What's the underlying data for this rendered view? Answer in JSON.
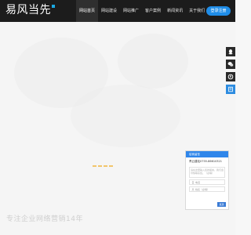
{
  "header": {
    "logo_text": "易风当先",
    "nav": [
      {
        "label": "网站首页",
        "active": true
      },
      {
        "label": "网站建设",
        "active": false
      },
      {
        "label": "网站推广",
        "active": false
      },
      {
        "label": "客户案例",
        "active": false
      },
      {
        "label": "新闻资讯",
        "active": false
      },
      {
        "label": "关于我们",
        "active": false
      }
    ],
    "login_label": "登录注册"
  },
  "hero": {
    "slogan": "专注企业网络营销14年"
  },
  "float_bar": {
    "icons": [
      "qq-icon",
      "wechat-icon",
      "phone-icon",
      "message-icon"
    ]
  },
  "message_widget": {
    "title": "给我留言",
    "phone_line": "青云建站0755-86610321",
    "textarea_placeholder": "请在这里输入您的留言，我们会尽快联系您。（必填）",
    "phone_placeholder": "电话",
    "name_placeholder": "姓名（必填）",
    "send_label": "发送"
  },
  "colors": {
    "header_bg": "#1c1c1c",
    "brand_blue": "#1f8de8",
    "loader": "#f2c56b"
  }
}
